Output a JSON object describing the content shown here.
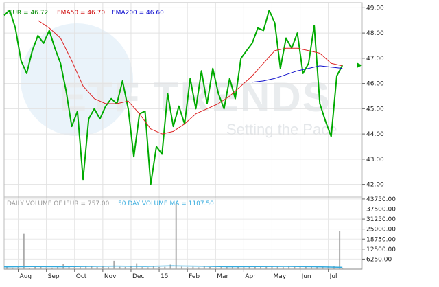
{
  "chart_data": [
    {
      "type": "line",
      "panel": "price",
      "legend": [
        {
          "text": "IEUR = 46.72",
          "color": "#008800"
        },
        {
          "text": "EMA50 = 46.70",
          "color": "#cc0000"
        },
        {
          "text": "EMA200 = 46.60",
          "color": "#0000cc"
        }
      ],
      "ylim": [
        41.5,
        49.2
      ],
      "yticks": [
        "49.00",
        "48.00",
        "47.00",
        "46.00",
        "45.00",
        "44.00",
        "43.00",
        "42.00"
      ],
      "ytick_values": [
        49,
        48,
        47,
        46,
        45,
        44,
        43,
        42
      ],
      "xlim": [
        0,
        12.7
      ],
      "xticks": [
        {
          "label": "Aug",
          "x": 0.5
        },
        {
          "label": "Sep",
          "x": 1.5
        },
        {
          "label": "Oct",
          "x": 2.5
        },
        {
          "label": "Nov",
          "x": 3.5
        },
        {
          "label": "Dec",
          "x": 4.5
        },
        {
          "label": "15",
          "x": 5.5
        },
        {
          "label": "Feb",
          "x": 6.5
        },
        {
          "label": "Mar",
          "x": 7.5
        },
        {
          "label": "Apr",
          "x": 8.5
        },
        {
          "label": "May",
          "x": 9.5
        },
        {
          "label": "Jun",
          "x": 10.5
        },
        {
          "label": "Jul",
          "x": 11.5
        }
      ],
      "grid": true,
      "watermark": {
        "main": "ETF TRENDS",
        "tagline": "Setting the Pace"
      },
      "series": [
        {
          "name": "IEUR",
          "color": "#00aa00",
          "x": [
            0.0,
            0.2,
            0.4,
            0.6,
            0.8,
            1.0,
            1.2,
            1.4,
            1.6,
            1.8,
            2.0,
            2.2,
            2.4,
            2.6,
            2.8,
            3.0,
            3.2,
            3.4,
            3.6,
            3.8,
            4.0,
            4.2,
            4.4,
            4.6,
            4.8,
            5.0,
            5.2,
            5.4,
            5.6,
            5.8,
            6.0,
            6.2,
            6.4,
            6.6,
            6.8,
            7.0,
            7.2,
            7.4,
            7.6,
            7.8,
            8.0,
            8.2,
            8.4,
            8.6,
            8.8,
            9.0,
            9.2,
            9.4,
            9.6,
            9.8,
            10.0,
            10.2,
            10.4,
            10.6,
            10.8,
            11.0,
            11.2,
            11.4,
            11.6,
            11.8,
            12.0
          ],
          "y": [
            48.7,
            48.9,
            48.2,
            46.9,
            46.4,
            47.3,
            47.9,
            47.6,
            48.1,
            47.4,
            46.8,
            45.7,
            44.3,
            44.9,
            42.2,
            44.6,
            45.0,
            44.6,
            45.1,
            45.4,
            45.2,
            46.1,
            45.0,
            43.1,
            44.8,
            44.9,
            42.0,
            43.5,
            43.2,
            45.6,
            44.3,
            45.1,
            44.4,
            46.2,
            45.0,
            46.5,
            45.2,
            46.6,
            45.6,
            45.0,
            46.2,
            45.4,
            47.0,
            47.3,
            47.6,
            48.2,
            48.1,
            48.9,
            48.4,
            46.6,
            47.8,
            47.4,
            48.0,
            46.4,
            46.8,
            48.3,
            45.2,
            44.5,
            43.9,
            46.3,
            46.72
          ]
        },
        {
          "name": "EMA50",
          "color": "#dd2222",
          "x": [
            1.2,
            1.6,
            2.0,
            2.4,
            2.8,
            3.2,
            3.6,
            4.0,
            4.4,
            4.8,
            5.2,
            5.6,
            6.0,
            6.4,
            6.8,
            7.2,
            7.6,
            8.0,
            8.4,
            8.8,
            9.2,
            9.6,
            10.0,
            10.4,
            10.8,
            11.2,
            11.6,
            12.0
          ],
          "y": [
            48.5,
            48.2,
            47.8,
            46.9,
            45.9,
            45.4,
            45.2,
            45.2,
            45.3,
            44.8,
            44.2,
            44.0,
            44.1,
            44.4,
            44.8,
            45.0,
            45.2,
            45.5,
            45.9,
            46.3,
            46.8,
            47.3,
            47.4,
            47.4,
            47.3,
            47.2,
            46.8,
            46.7
          ]
        },
        {
          "name": "EMA200",
          "color": "#1111cc",
          "x": [
            8.8,
            9.2,
            9.6,
            10.0,
            10.4,
            10.8,
            11.2,
            11.6,
            12.0
          ],
          "y": [
            46.05,
            46.1,
            46.2,
            46.35,
            46.5,
            46.6,
            46.7,
            46.65,
            46.6
          ]
        }
      ],
      "current_value_tag": 46.72
    },
    {
      "type": "bar",
      "panel": "volume",
      "legend": [
        {
          "text": "DAILY VOLUME OF IEUR = 757.00",
          "color": "#999999"
        },
        {
          "text": "50 DAY VOLUME MA = 1107.50",
          "color": "#33aadd"
        }
      ],
      "ylim": [
        0,
        45000
      ],
      "yticks": [
        "43750.00",
        "37500.00",
        "31250.00",
        "25000.00",
        "18750.00",
        "12500.00",
        "6250.00"
      ],
      "ytick_values": [
        43750,
        37500,
        31250,
        25000,
        18750,
        12500,
        6250
      ],
      "bars": {
        "color": "#aaaaaa",
        "x": [
          0.1,
          0.3,
          0.5,
          0.7,
          0.9,
          1.1,
          1.3,
          1.5,
          1.7,
          1.9,
          2.1,
          2.3,
          2.5,
          2.7,
          2.9,
          3.1,
          3.3,
          3.5,
          3.7,
          3.9,
          4.1,
          4.3,
          4.5,
          4.7,
          4.9,
          5.1,
          5.3,
          5.5,
          5.7,
          5.9,
          6.1,
          6.3,
          6.5,
          6.7,
          6.9,
          7.1,
          7.3,
          7.5,
          7.7,
          7.9,
          8.1,
          8.3,
          8.5,
          8.7,
          8.9,
          9.1,
          9.3,
          9.5,
          9.7,
          9.9,
          10.1,
          10.3,
          10.5,
          10.7,
          10.9,
          11.1,
          11.3,
          11.5,
          11.7,
          11.9,
          12.0
        ],
        "values": [
          1200,
          900,
          1500,
          22000,
          800,
          1400,
          1600,
          1100,
          900,
          1800,
          3200,
          1500,
          1700,
          1200,
          2100,
          1500,
          1300,
          1900,
          1200,
          5200,
          1400,
          1300,
          1500,
          3600,
          1200,
          1100,
          1600,
          1300,
          1400,
          2800,
          41000,
          1500,
          1200,
          1400,
          1100,
          1600,
          1300,
          1200,
          1700,
          1500,
          1800,
          1300,
          1600,
          1400,
          1500,
          1900,
          2000,
          1700,
          1500,
          1200,
          1800,
          1500,
          1700,
          1400,
          1600,
          1300,
          1500,
          1800,
          1700,
          24000,
          757
        ]
      },
      "ma": {
        "name": "50 DAY VOLUME MA",
        "color": "#33aadd",
        "x": [
          0.0,
          1.0,
          2.0,
          3.0,
          4.0,
          5.0,
          6.0,
          7.0,
          8.0,
          9.0,
          10.0,
          11.0,
          12.0
        ],
        "values": [
          1400,
          1600,
          1500,
          1700,
          1900,
          1700,
          2000,
          1800,
          1500,
          1600,
          1700,
          1500,
          1107.5
        ]
      }
    }
  ]
}
